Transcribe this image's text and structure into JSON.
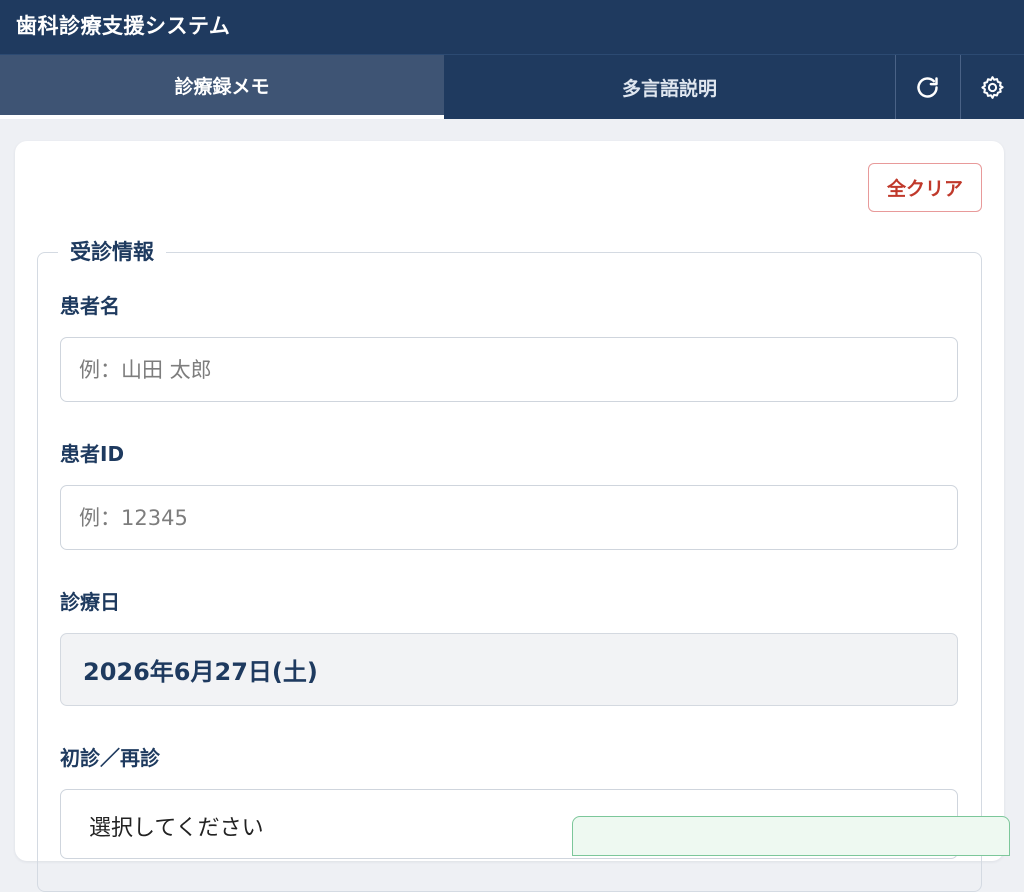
{
  "app": {
    "title": "歯科診療支援システム"
  },
  "tabs": {
    "memo": "診療録メモ",
    "multilingual": "多言語説明"
  },
  "icons": {
    "refresh": "refresh-icon",
    "settings": "gear-icon"
  },
  "card": {
    "clear_label": "全クリア",
    "section_title": "受診情報"
  },
  "fields": {
    "patient_name": {
      "label": "患者名",
      "placeholder": "例：山田 太郎",
      "value": ""
    },
    "patient_id": {
      "label": "患者ID",
      "placeholder": "例：12345",
      "value": ""
    },
    "visit_date": {
      "label": "診療日",
      "value": "2026年6月27日(土)"
    },
    "visit_type": {
      "label": "初診／再診",
      "selected": "選択してください"
    }
  },
  "colors": {
    "header_bg": "#1f3a5f",
    "active_tab_bg": "#3e5474",
    "clear_button": "#c0392b",
    "text_primary": "#1e3a5f"
  }
}
